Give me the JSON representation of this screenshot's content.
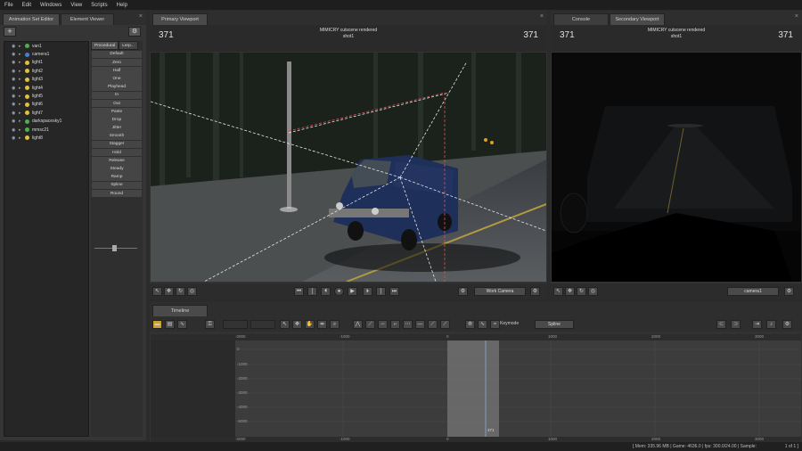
{
  "menu": [
    "File",
    "Edit",
    "Windows",
    "View",
    "Scripts",
    "Help"
  ],
  "left_panel": {
    "tabs": [
      "Animation Set Editor",
      "Element Viewer"
    ],
    "add_label": "+",
    "items": [
      {
        "label": "van1",
        "color": "#4caf50"
      },
      {
        "label": "camera1",
        "color": "#4a7fd0"
      },
      {
        "label": "light1",
        "color": "#e0c040"
      },
      {
        "label": "light2",
        "color": "#e0c040"
      },
      {
        "label": "light3",
        "color": "#e0c040"
      },
      {
        "label": "light4",
        "color": "#e0c040"
      },
      {
        "label": "light5",
        "color": "#e0c040"
      },
      {
        "label": "light6",
        "color": "#e0c040"
      },
      {
        "label": "light7",
        "color": "#e0c040"
      },
      {
        "label": "darkspacesky1",
        "color": "#4caf50"
      },
      {
        "label": "mmsc21",
        "color": "#4caf50"
      },
      {
        "label": "light8",
        "color": "#e0c040"
      }
    ],
    "preset_tabs": [
      "Procedural",
      "Lerp..."
    ],
    "presets": [
      "Default",
      "Zero",
      "Half",
      "One",
      "Playhead",
      "In",
      "Out",
      "Paste",
      "Drop",
      "Jitter",
      "Smooth",
      "Stagger",
      "Hold",
      "Release",
      "Steady",
      "Ramp",
      "Spline",
      "Round"
    ]
  },
  "primary": {
    "tab": "Primary Viewport",
    "title_line1": "MIMICRY cutscene rendered",
    "title_line2": "shot1",
    "frame_left": "371",
    "frame_right": "371",
    "camera_select": "Work Camera"
  },
  "secondary": {
    "tabs": [
      "Console",
      "Secondary Viewport"
    ],
    "title_line1": "MIMICRY cutscene rendered",
    "title_line2": "shot1",
    "frame_left": "371",
    "frame_right": "371",
    "camera_select": "camera1"
  },
  "timeline": {
    "tab": "Timeline",
    "keymode_label": "Keymode",
    "keymode_value": "Spline",
    "ruler_top": [
      "-2000",
      "-1000",
      "0",
      "1000",
      "2000",
      "3000"
    ],
    "ruler_bottom": [
      "-2000",
      "-1000",
      "0",
      "1000",
      "2000",
      "3000"
    ],
    "y_labels": [
      "0",
      "-1000",
      "-2000",
      "-3000",
      "-4000",
      "-5000"
    ],
    "playhead": "371"
  },
  "status": {
    "mem": "[ Mem:   335.96 MB | Game:   4636.0 | fps:  300.0/24.00 | Sample:",
    "page": "1 of 1 ]"
  }
}
